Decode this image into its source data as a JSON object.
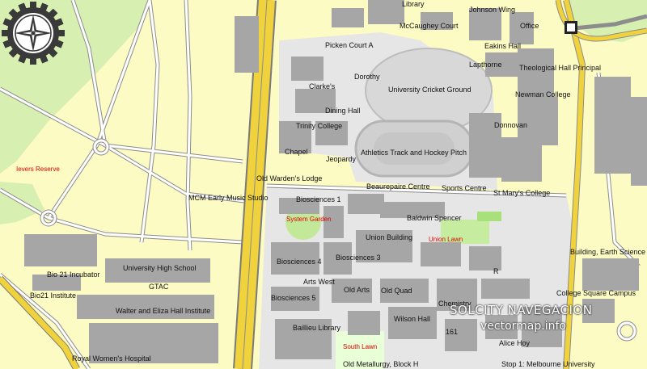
{
  "map": {
    "colors": {
      "land": "#fdfbc4",
      "campus": "#e6e6e6",
      "building": "#a6a6a6",
      "park": "#d7efb0",
      "lawn": "#a8e07c",
      "highway": "#f0d23c",
      "road": "#ffffff",
      "road_casing": "#8c8c8c",
      "label_red": "#e00000"
    },
    "labels": {
      "library": "Library",
      "johnson_wing": "Johnson Wing",
      "mccaughey_court": "McCaughey Court",
      "office": "Office",
      "picken_court_a": "Picken Court A",
      "eakins_hall": "Eakins Hall",
      "lapthorne": "Lapthorne",
      "theological_hall_principal": "Theological Hall Principal",
      "dorothy": "Dorothy",
      "clarkes": "Clarke's",
      "university_cricket_ground": "University Cricket Ground",
      "newman_college": "Newman College",
      "dining_hall": "Dining Hall",
      "trinity_college": "Trinity College",
      "donnovan": "Donnovan",
      "ievers_reserve": "Ievers Reserve",
      "chapel": "Chapel",
      "athletics_track": "Athletics Track and Hockey Pitch",
      "jeopardy": "Jeopardy",
      "old_wardens_lodge": "Old Warden's Lodge",
      "beaurepaire_centre": "Beaurepaire Centre",
      "sports_centre": "Sports Centre",
      "st_marys_college": "St Mary's College",
      "mcm_early_music_studio": "MCM Early Music Studio",
      "biosciences_1": "Biosciences 1",
      "system_garden": "System Garden",
      "baldwin_spencer": "Baldwin Spencer",
      "union_building": "Union Building",
      "union_lawn": "Union Lawn",
      "building_earth_science": "Building, Earth Science",
      "biosciences_4": "Biosciences 4",
      "biosciences_3": "Biosciences 3",
      "bio21_incubator": "Bio 21 Incubator",
      "university_high_school": "University High School",
      "arts_west": "Arts West",
      "gtac": "GTAC",
      "bio21_institute": "Bio21 Institute",
      "old_arts": "Old Arts",
      "old_quad": "Old Quad",
      "college_square_campus": "College Square Campus",
      "biosciences_5": "Biosciences 5",
      "chemistry": "Chemistry",
      "walter_eliza_hall": "Walter and Eliza Hall Institute",
      "wilson_hall": "Wilson Hall",
      "baillieu_library": "Baillieu Library",
      "b161": "161",
      "south_lawn": "South Lawn",
      "alice_hoy": "Alice Hoy",
      "royal_womens_hospital": "Royal Women's Hospital",
      "old_metallurgy": "Old Metallurgy, Block H",
      "stop1": "Stop 1: Melbourne University",
      "r_partial": "R"
    },
    "watermark": {
      "title": "SOLCITY NAVEGACION",
      "url": "vectormap.info"
    },
    "icons": {
      "logo": "compass-gear-icon",
      "sign": "route-sign-icon"
    }
  }
}
